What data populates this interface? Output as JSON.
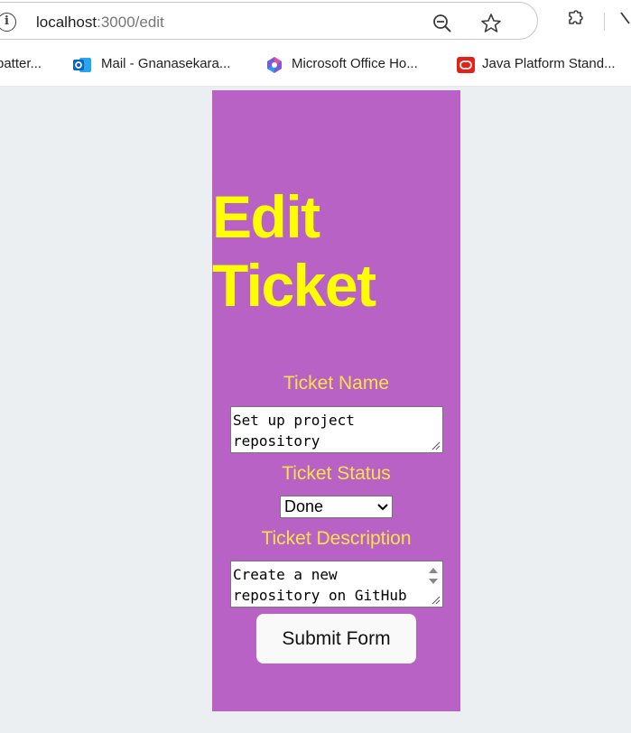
{
  "browser": {
    "url_host": "localhost",
    "url_path": ":3000/edit",
    "icons": [
      "info-icon",
      "zoom-out-icon",
      "star-icon",
      "extensions-icon",
      "more-icon"
    ]
  },
  "bookmarks": [
    {
      "label": "batter...",
      "icon": "none"
    },
    {
      "label": "Mail - Gnanasekara...",
      "icon": "outlook-icon"
    },
    {
      "label": "Microsoft Office Ho...",
      "icon": "office-icon"
    },
    {
      "label": "Java Platform Stand...",
      "icon": "oracle-icon"
    }
  ],
  "page": {
    "title_line1": "Edit",
    "title_line2": "Ticket",
    "ticket_name_label": "Ticket Name",
    "ticket_name_line1": "Set up project",
    "ticket_name_line2": "repository",
    "ticket_status_label": "Ticket Status",
    "ticket_status_value": "Done",
    "ticket_description_label": "Ticket Description",
    "ticket_description_line1": "Create a new",
    "ticket_description_line2": "repository on GitHub",
    "submit_label": "Submit Form"
  },
  "colors": {
    "panel_bg": "#b762c4",
    "title": "#ffff00",
    "label": "#ffe24a",
    "page_bg": "#eceff1"
  }
}
